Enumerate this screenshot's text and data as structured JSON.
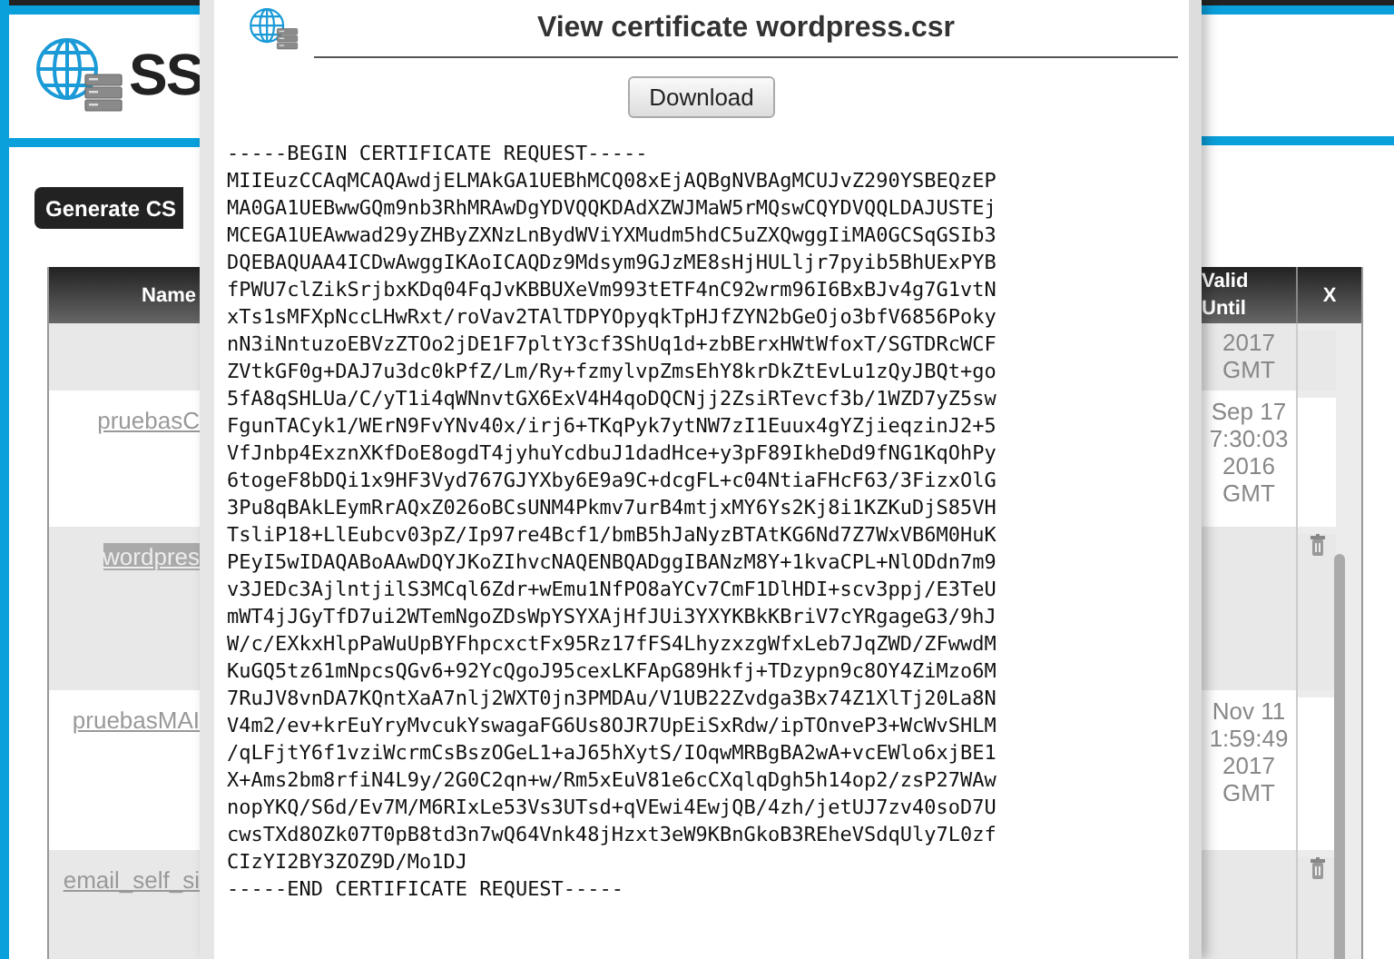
{
  "background_page": {
    "header": {
      "logo_text": "SS"
    },
    "generate_button": "Generate CS",
    "table": {
      "columns": [
        "Name",
        "Valid Until",
        "X"
      ],
      "rows": [
        {
          "valid_until": [
            "2017",
            "GMT"
          ],
          "deletable": false
        },
        {
          "name": "pruebasC",
          "valid_until": [
            "Sep 17",
            "7:30:03",
            "2016",
            "GMT"
          ],
          "deletable": false,
          "selected": false
        },
        {
          "name": "wordpres",
          "deletable": true,
          "selected": true
        },
        {
          "name": "pruebasMAI",
          "valid_until": [
            "Nov 11",
            "1:59:49",
            "2017",
            "GMT"
          ],
          "deletable": false,
          "selected": false
        },
        {
          "name": "email_self_si",
          "deletable": true,
          "selected": false
        }
      ]
    }
  },
  "dialog": {
    "title": "View certificate wordpress.csr",
    "download_button": "Download",
    "certificate_lines": [
      "-----BEGIN CERTIFICATE REQUEST-----",
      "MIIEuzCCAqMCAQAwdjELMAkGA1UEBhMCQ08xEjAQBgNVBAgMCUJvZ290YSBEQzEP",
      "MA0GA1UEBwwGQm9nb3RhMRAwDgYDVQQKDAdXZWJMaW5rMQswCQYDVQQLDAJUSTEj",
      "MCEGA1UEAwwad29yZHByZXNzLnBydWViYXMudm5hdC5uZXQwggIiMA0GCSqGSIb3",
      "DQEBAQUAA4ICDwAwggIKAoICAQDz9Mdsym9GJzME8sHjHULljr7pyib5BhUExPYB",
      "fPWU7clZikSrjbxKDq04FqJvKBBUXeVm993tETF4nC92wrm96I6BxBJv4g7G1vtN",
      "xTs1sMFXpNccLHwRxt/roVav2TAlTDPYOpyqkTpHJfZYN2bGeOjo3bfV6856Poky",
      "nN3iNntuzoEBVzZTOo2jDE1F7pltY3cf3ShUq1d+zbBErxHWtWfoxT/SGTDRcWCF",
      "ZVtkGF0g+DAJ7u3dc0kPfZ/Lm/Ry+fzmylvpZmsEhY8krDkZtEvLu1zQyJBQt+go",
      "5fA8qSHLUa/C/yT1i4qWNnvtGX6ExV4H4qoDQCNjj2ZsiRTevcf3b/1WZD7yZ5sw",
      "FgunTACyk1/WErN9FvYNv40x/irj6+TKqPyk7ytNW7zI1Euux4gYZjieqzinJ2+5",
      "VfJnbp4ExznXKfDoE8ogdT4jyhuYcdbuJ1dadHce+y3pF89IkheDd9fNG1KqOhPy",
      "6togeF8bDQi1x9HF3Vyd767GJYXby6E9a9C+dcgFL+c04NtiaFHcF63/3FizxOlG",
      "3Pu8qBAkLEymRrAQxZ026oBCsUNM4Pkmv7urB4mtjxMY6Ys2Kj8i1KZKuDjS85VH",
      "TsliP18+LlEubcv03pZ/Ip97re4Bcf1/bmB5hJaNyzBTAtKG6Nd7Z7WxVB6M0HuK",
      "PEyI5wIDAQABoAAwDQYJKoZIhvcNAQENBQADggIBANzM8Y+1kvaCPL+NlODdn7m9",
      "v3JEDc3AjlntjilS3MCql6Zdr+wEmu1NfPO8aYCv7CmF1DlHDI+scv3ppj/E3TeU",
      "mWT4jJGyTfD7ui2WTemNgoZDsWpYSYXAjHfJUi3YXYKBkKBriV7cYRgageG3/9hJ",
      "W/c/EXkxHlpPaWuUpBYFhpcxctFx95Rz17fFS4LhyzxzgWfxLeb7JqZWD/ZFwwdM",
      "KuGQ5tz61mNpcsQGv6+92YcQgoJ95cexLKFApG89Hkfj+TDzypn9c8OY4ZiMzo6M",
      "7RuJV8vnDA7KQntXaA7nlj2WXT0jn3PMDAu/V1UB22Zvdga3Bx74Z1XlTj20La8N",
      "V4m2/ev+krEuYryMvcukYswagaFG6Us8OJR7UpEiSxRdw/ipTOnveP3+WcWvSHLM",
      "/qLFjtY6f1vziWcrmCsBszOGeL1+aJ65hXytS/IOqwMRBgBA2wA+vcEWlo6xjBE1",
      "X+Ams2bm8rfiN4L9y/2G0C2qn+w/Rm5xEuV81e6cCXqlqDgh5h14op2/zsP27WAw",
      "nopYKQ/S6d/Ev7M/M6RIxLe53Vs3UTsd+qVEwi4EwjQB/4zh/jetUJ7zv40soD7U",
      "cwsTXd8OZk07T0pB8td3n7wQ64Vnk48jHzxt3eW9KBnGkoB3REheVSdqUly7L0zf",
      "CIzYI2BY3ZOZ9D/Mo1DJ",
      "-----END CERTIFICATE REQUEST-----"
    ]
  }
}
